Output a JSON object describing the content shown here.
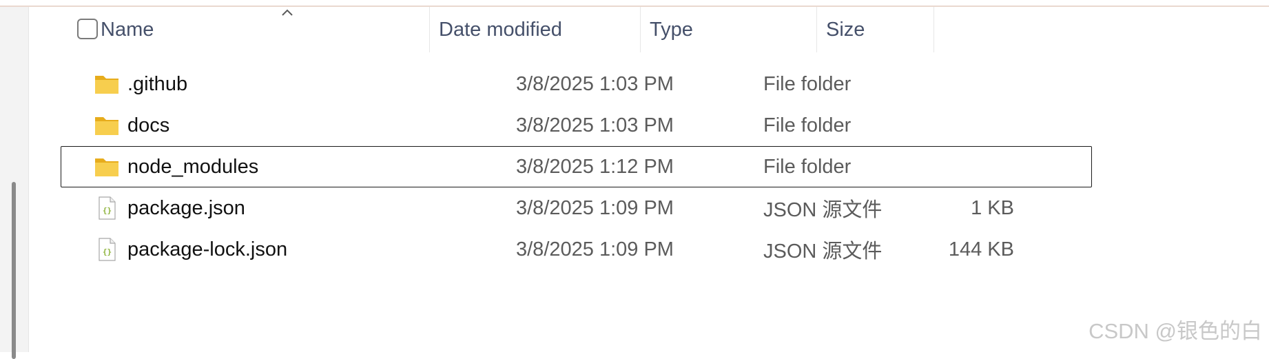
{
  "header": {
    "name": "Name",
    "date_modified": "Date modified",
    "type": "Type",
    "size": "Size"
  },
  "files": [
    {
      "name": ".github",
      "date": "3/8/2025 1:03 PM",
      "type": "File folder",
      "size": "",
      "icon": "folder-icon",
      "selected": false
    },
    {
      "name": "docs",
      "date": "3/8/2025 1:03 PM",
      "type": "File folder",
      "size": "",
      "icon": "folder-icon",
      "selected": false
    },
    {
      "name": "node_modules",
      "date": "3/8/2025 1:12 PM",
      "type": "File folder",
      "size": "",
      "icon": "folder-icon",
      "selected": true
    },
    {
      "name": "package.json",
      "date": "3/8/2025 1:09 PM",
      "type": "JSON 源文件",
      "size": "1 KB",
      "icon": "json-file-icon",
      "selected": false
    },
    {
      "name": "package-lock.json",
      "date": "3/8/2025 1:09 PM",
      "type": "JSON 源文件",
      "size": "144 KB",
      "icon": "json-file-icon",
      "selected": false
    }
  ],
  "watermark": "CSDN @银色的白",
  "colors": {
    "folder": "#f4c542",
    "folder_dark": "#e7ac1c",
    "json_brace": "#8db33a",
    "header_text": "#45506a",
    "secondary_text": "#5b5b5b"
  }
}
